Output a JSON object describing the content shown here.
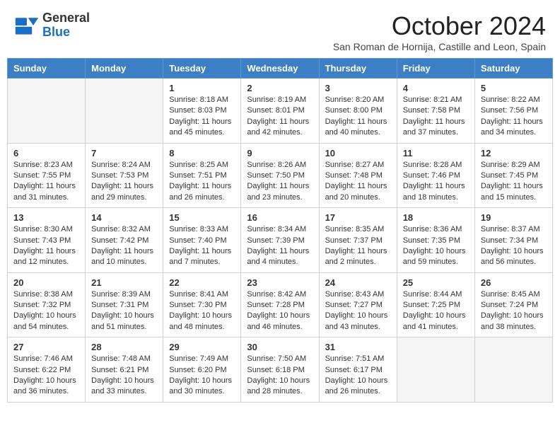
{
  "header": {
    "logo_general": "General",
    "logo_blue": "Blue",
    "month_title": "October 2024",
    "subtitle": "San Roman de Hornija, Castille and Leon, Spain"
  },
  "days_of_week": [
    "Sunday",
    "Monday",
    "Tuesday",
    "Wednesday",
    "Thursday",
    "Friday",
    "Saturday"
  ],
  "weeks": [
    [
      {
        "day": "",
        "info": ""
      },
      {
        "day": "",
        "info": ""
      },
      {
        "day": "1",
        "info": "Sunrise: 8:18 AM\nSunset: 8:03 PM\nDaylight: 11 hours and 45 minutes."
      },
      {
        "day": "2",
        "info": "Sunrise: 8:19 AM\nSunset: 8:01 PM\nDaylight: 11 hours and 42 minutes."
      },
      {
        "day": "3",
        "info": "Sunrise: 8:20 AM\nSunset: 8:00 PM\nDaylight: 11 hours and 40 minutes."
      },
      {
        "day": "4",
        "info": "Sunrise: 8:21 AM\nSunset: 7:58 PM\nDaylight: 11 hours and 37 minutes."
      },
      {
        "day": "5",
        "info": "Sunrise: 8:22 AM\nSunset: 7:56 PM\nDaylight: 11 hours and 34 minutes."
      }
    ],
    [
      {
        "day": "6",
        "info": "Sunrise: 8:23 AM\nSunset: 7:55 PM\nDaylight: 11 hours and 31 minutes."
      },
      {
        "day": "7",
        "info": "Sunrise: 8:24 AM\nSunset: 7:53 PM\nDaylight: 11 hours and 29 minutes."
      },
      {
        "day": "8",
        "info": "Sunrise: 8:25 AM\nSunset: 7:51 PM\nDaylight: 11 hours and 26 minutes."
      },
      {
        "day": "9",
        "info": "Sunrise: 8:26 AM\nSunset: 7:50 PM\nDaylight: 11 hours and 23 minutes."
      },
      {
        "day": "10",
        "info": "Sunrise: 8:27 AM\nSunset: 7:48 PM\nDaylight: 11 hours and 20 minutes."
      },
      {
        "day": "11",
        "info": "Sunrise: 8:28 AM\nSunset: 7:46 PM\nDaylight: 11 hours and 18 minutes."
      },
      {
        "day": "12",
        "info": "Sunrise: 8:29 AM\nSunset: 7:45 PM\nDaylight: 11 hours and 15 minutes."
      }
    ],
    [
      {
        "day": "13",
        "info": "Sunrise: 8:30 AM\nSunset: 7:43 PM\nDaylight: 11 hours and 12 minutes."
      },
      {
        "day": "14",
        "info": "Sunrise: 8:32 AM\nSunset: 7:42 PM\nDaylight: 11 hours and 10 minutes."
      },
      {
        "day": "15",
        "info": "Sunrise: 8:33 AM\nSunset: 7:40 PM\nDaylight: 11 hours and 7 minutes."
      },
      {
        "day": "16",
        "info": "Sunrise: 8:34 AM\nSunset: 7:39 PM\nDaylight: 11 hours and 4 minutes."
      },
      {
        "day": "17",
        "info": "Sunrise: 8:35 AM\nSunset: 7:37 PM\nDaylight: 11 hours and 2 minutes."
      },
      {
        "day": "18",
        "info": "Sunrise: 8:36 AM\nSunset: 7:35 PM\nDaylight: 10 hours and 59 minutes."
      },
      {
        "day": "19",
        "info": "Sunrise: 8:37 AM\nSunset: 7:34 PM\nDaylight: 10 hours and 56 minutes."
      }
    ],
    [
      {
        "day": "20",
        "info": "Sunrise: 8:38 AM\nSunset: 7:32 PM\nDaylight: 10 hours and 54 minutes."
      },
      {
        "day": "21",
        "info": "Sunrise: 8:39 AM\nSunset: 7:31 PM\nDaylight: 10 hours and 51 minutes."
      },
      {
        "day": "22",
        "info": "Sunrise: 8:41 AM\nSunset: 7:30 PM\nDaylight: 10 hours and 48 minutes."
      },
      {
        "day": "23",
        "info": "Sunrise: 8:42 AM\nSunset: 7:28 PM\nDaylight: 10 hours and 46 minutes."
      },
      {
        "day": "24",
        "info": "Sunrise: 8:43 AM\nSunset: 7:27 PM\nDaylight: 10 hours and 43 minutes."
      },
      {
        "day": "25",
        "info": "Sunrise: 8:44 AM\nSunset: 7:25 PM\nDaylight: 10 hours and 41 minutes."
      },
      {
        "day": "26",
        "info": "Sunrise: 8:45 AM\nSunset: 7:24 PM\nDaylight: 10 hours and 38 minutes."
      }
    ],
    [
      {
        "day": "27",
        "info": "Sunrise: 7:46 AM\nSunset: 6:22 PM\nDaylight: 10 hours and 36 minutes."
      },
      {
        "day": "28",
        "info": "Sunrise: 7:48 AM\nSunset: 6:21 PM\nDaylight: 10 hours and 33 minutes."
      },
      {
        "day": "29",
        "info": "Sunrise: 7:49 AM\nSunset: 6:20 PM\nDaylight: 10 hours and 30 minutes."
      },
      {
        "day": "30",
        "info": "Sunrise: 7:50 AM\nSunset: 6:18 PM\nDaylight: 10 hours and 28 minutes."
      },
      {
        "day": "31",
        "info": "Sunrise: 7:51 AM\nSunset: 6:17 PM\nDaylight: 10 hours and 26 minutes."
      },
      {
        "day": "",
        "info": ""
      },
      {
        "day": "",
        "info": ""
      }
    ]
  ]
}
